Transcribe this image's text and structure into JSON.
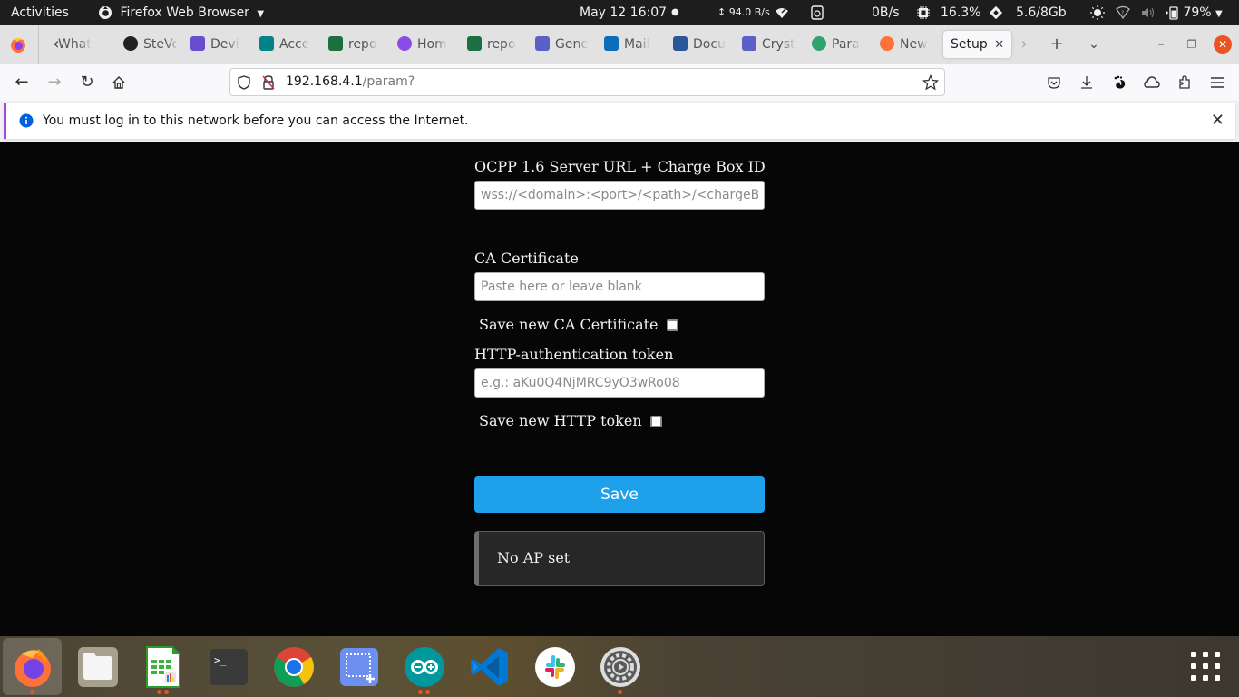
{
  "topbar": {
    "activities": "Activities",
    "app_name": "Firefox Web Browser",
    "datetime": "May 12  16:07",
    "net_speed": "94.0 B/s",
    "disk_io": "0B/s",
    "cpu": "16.3%",
    "memory": "5.6/8Gb",
    "battery": "79%"
  },
  "tabs": [
    {
      "label": "What",
      "icon": "whatsapp-icon",
      "color": "#555555"
    },
    {
      "label": "SteVe",
      "icon": "steve-icon",
      "color": "#222222"
    },
    {
      "label": "Devi",
      "icon": "device-icon",
      "color": "#6a4ccf"
    },
    {
      "label": "Acce",
      "icon": "sharepoint-icon",
      "color": "#038387"
    },
    {
      "label": "repo",
      "icon": "excel-icon",
      "color": "#1d6f42"
    },
    {
      "label": "Hom",
      "icon": "microsoft365-icon",
      "color": "#8a4ce6"
    },
    {
      "label": "repo",
      "icon": "excel-icon",
      "color": "#1d6f42"
    },
    {
      "label": "Gene",
      "icon": "teams-icon",
      "color": "#5b5fc7"
    },
    {
      "label": "Mail",
      "icon": "outlook-icon",
      "color": "#0f6cbd"
    },
    {
      "label": "Docu",
      "icon": "word-icon",
      "color": "#2b579a"
    },
    {
      "label": "Cryst",
      "icon": "teams-icon",
      "color": "#5b5fc7"
    },
    {
      "label": "Para",
      "icon": "chatbot-icon",
      "color": "#2ea36b"
    },
    {
      "label": "New",
      "icon": "firefox-icon",
      "color": "#ff7139"
    }
  ],
  "active_tab": {
    "label": "Setup"
  },
  "navbar": {
    "url_host": "192.168.4.1",
    "url_path": "/param?"
  },
  "notification": {
    "text": "You must log in to this network before you can access the Internet."
  },
  "form": {
    "ocpp_label": "OCPP 1.6 Server URL + Charge Box ID",
    "ocpp_placeholder": "wss://<domain>:<port>/<path>/<chargeBoxId>",
    "ocpp_value": "",
    "ca_label": "CA Certificate",
    "ca_placeholder": "Paste here or leave blank",
    "ca_value": "",
    "save_ca_label": "Save new CA Certificate",
    "save_ca_checked": false,
    "http_label": "HTTP-authentication token",
    "http_placeholder": "e.g.: aKu0Q4NjMRC9yO3wRo08",
    "http_value": "",
    "save_http_label": "Save new HTTP token",
    "save_http_checked": false,
    "save_button": "Save",
    "status_text": "No AP set"
  },
  "dock": {
    "apps": [
      "Firefox",
      "Files",
      "LibreOffice Calc",
      "Terminal",
      "Google Chrome",
      "Screenshot",
      "Arduino IDE",
      "Visual Studio Code",
      "Slack",
      "Settings"
    ]
  },
  "colors": {
    "accent": "#1ea1ea",
    "notice_accent": "#a24cdd",
    "ubuntu_orange": "#e95420"
  }
}
